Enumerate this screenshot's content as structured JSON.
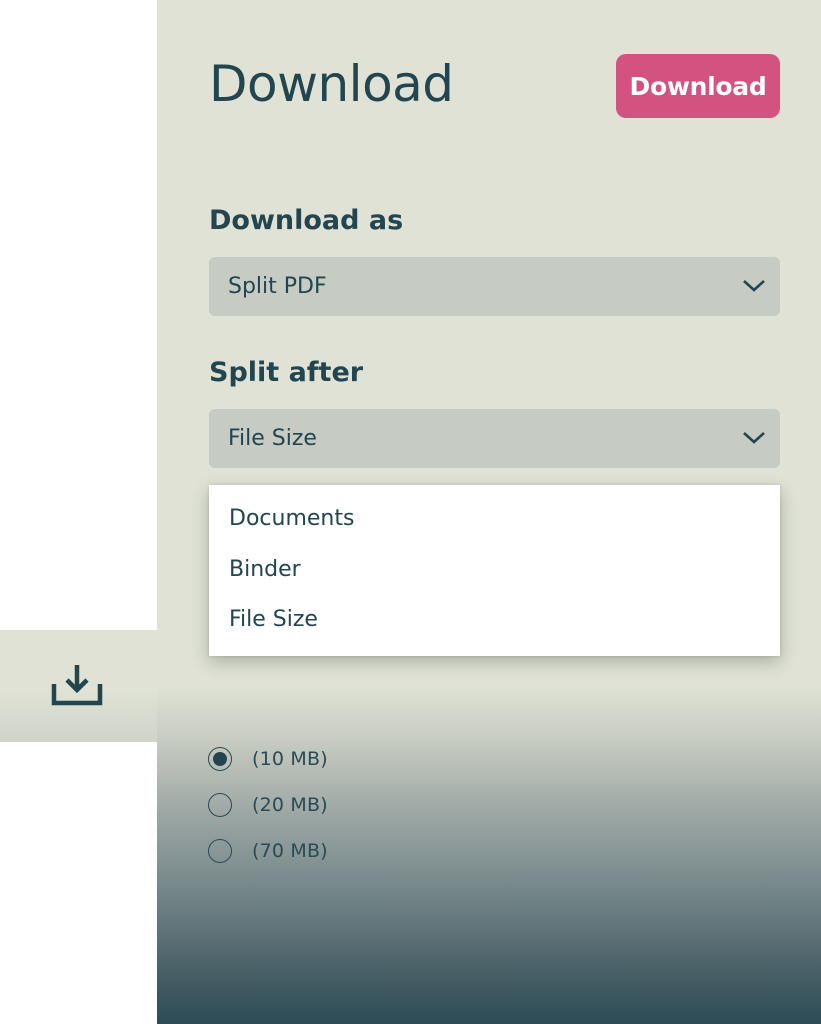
{
  "header": {
    "title": "Download",
    "download_button_label": "Download"
  },
  "download_as": {
    "label": "Download as",
    "selected_value": "Split PDF"
  },
  "split_after": {
    "label": "Split after",
    "selected_value": "File Size",
    "options": [
      "Documents",
      "Binder",
      "File Size"
    ]
  },
  "size_options": [
    {
      "label": "(10 MB)",
      "checked": true
    },
    {
      "label": "(20 MB)",
      "checked": false
    },
    {
      "label": "(70 MB)",
      "checked": false
    }
  ],
  "side_tab": {
    "icon": "download-tray-icon"
  },
  "colors": {
    "accent": "#d3527f",
    "text": "#22454f",
    "panel_bg": "#dfe2d5",
    "select_bg": "#c6cbc4",
    "gradient_end": "#2d4c55"
  }
}
